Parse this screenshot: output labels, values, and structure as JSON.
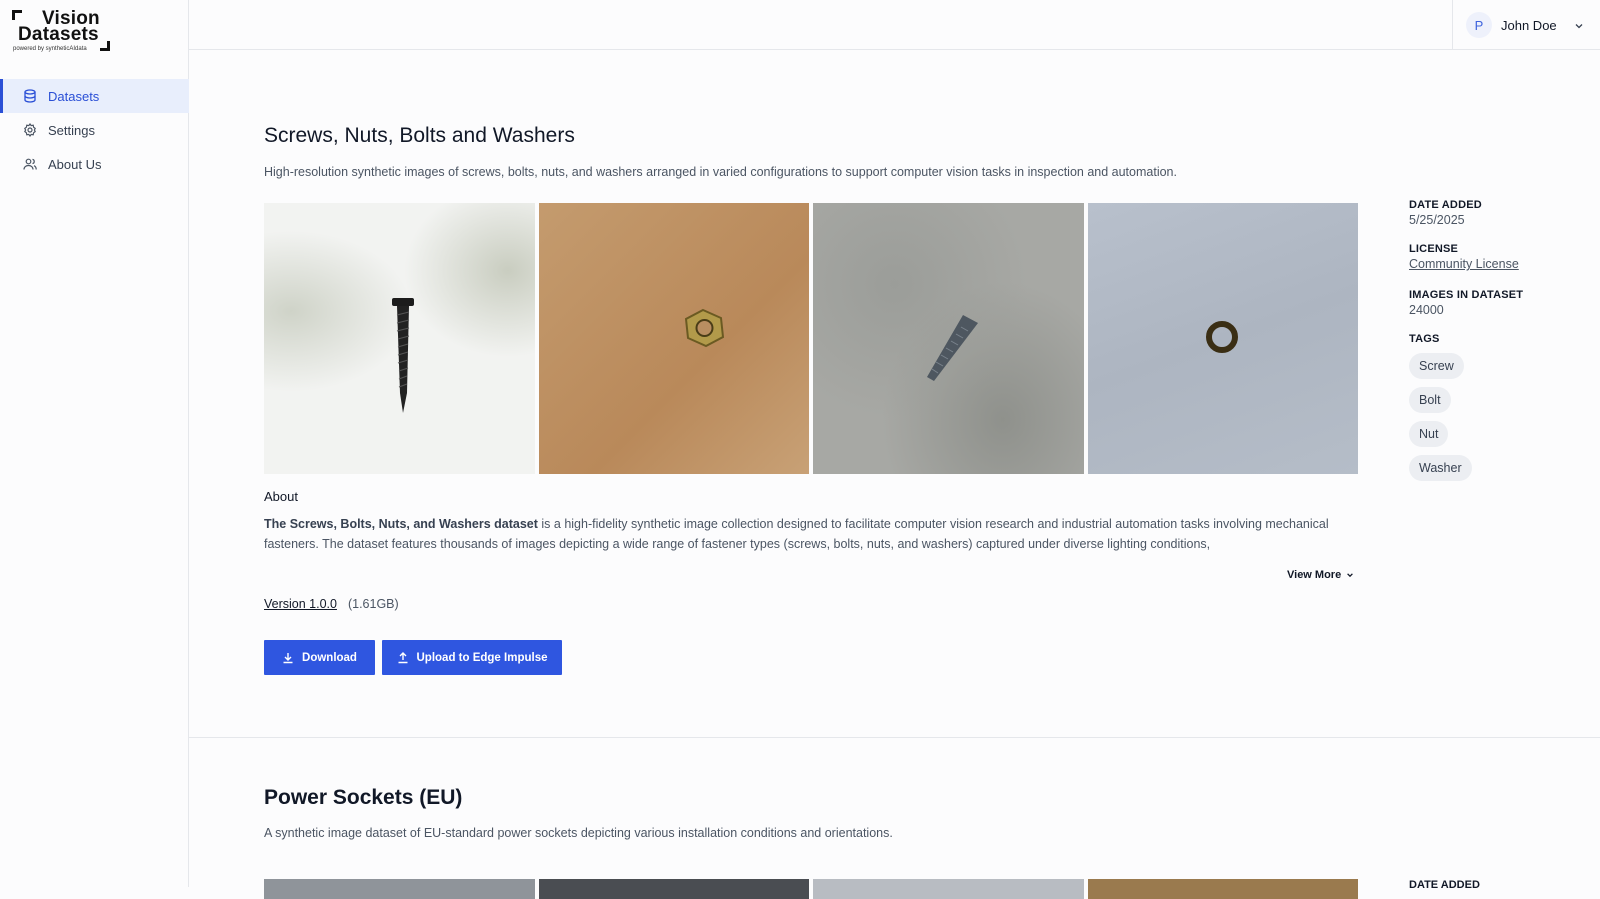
{
  "logo": {
    "line1": "Vision",
    "line2": "Datasets",
    "tagline": "powered by syntheticAIdata"
  },
  "sidebar": {
    "items": [
      {
        "label": "Datasets",
        "icon": "database-icon",
        "active": true
      },
      {
        "label": "Settings",
        "icon": "gear-icon",
        "active": false
      },
      {
        "label": "About Us",
        "icon": "users-icon",
        "active": false
      }
    ]
  },
  "user": {
    "initial": "P",
    "name": "John Doe"
  },
  "dataset1": {
    "title": "Screws, Nuts, Bolts and Washers",
    "description": "High-resolution synthetic images of screws, bolts, nuts, and washers arranged in varied configurations to support computer vision tasks in inspection and automation.",
    "images": [
      "screw image",
      "nut image",
      "bolt image",
      "washer image"
    ],
    "meta": {
      "date_label": "DATE ADDED",
      "date_value": "5/25/2025",
      "license_label": "LICENSE",
      "license_value": "Community License",
      "images_label": "IMAGES IN DATASET",
      "images_value": "24000",
      "tags_label": "TAGS",
      "tags": [
        "Screw",
        "Bolt",
        "Nut",
        "Washer"
      ]
    },
    "about_heading": "About",
    "about_bold": "The Screws, Bolts, Nuts, and Washers dataset",
    "about_text": " is a high-fidelity synthetic image collection designed to facilitate computer vision research and industrial automation tasks involving mechanical fasteners. The dataset features thousands of images depicting a wide range of fastener types (screws, bolts, nuts, and washers) captured under diverse lighting conditions,",
    "view_more": "View More",
    "version": "Version 1.0.0",
    "size": "(1.61GB)",
    "download_label": "Download",
    "upload_label": "Upload to Edge Impulse"
  },
  "dataset2": {
    "title": "Power Sockets (EU)",
    "description": "A synthetic image dataset of EU-standard power sockets depicting various installation conditions and orientations.",
    "date_label": "DATE ADDED"
  }
}
